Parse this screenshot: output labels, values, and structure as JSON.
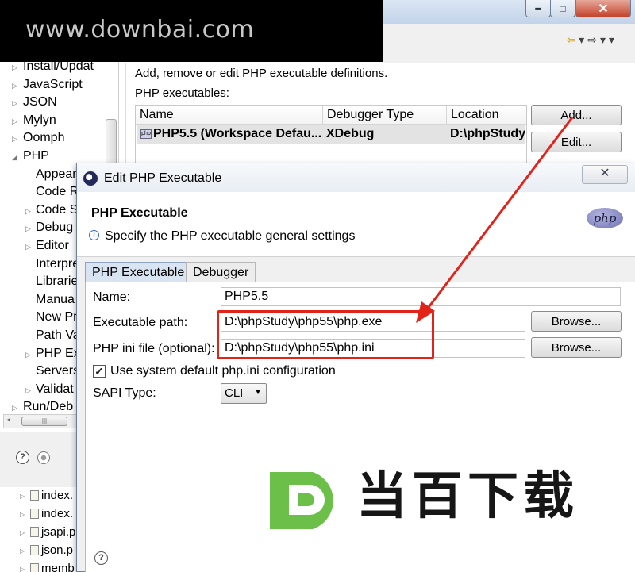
{
  "banner": {
    "text": "www.downbai.com"
  },
  "prefs": {
    "window_buttons": {
      "minimize": "━",
      "maximize": "□",
      "close": "✕"
    },
    "tree": [
      {
        "label": "Install/Updat",
        "arrow": "▷"
      },
      {
        "label": "JavaScript",
        "arrow": "▷"
      },
      {
        "label": "JSON",
        "arrow": "▷"
      },
      {
        "label": "Mylyn",
        "arrow": "▷"
      },
      {
        "label": "Oomph",
        "arrow": "▷"
      },
      {
        "label": "PHP",
        "arrow": "◢"
      },
      {
        "label": "Appear",
        "arrow": ""
      },
      {
        "label": "Code R",
        "arrow": ""
      },
      {
        "label": "Code S",
        "arrow": "▷"
      },
      {
        "label": "Debug",
        "arrow": "▷"
      },
      {
        "label": "Editor",
        "arrow": "▷"
      },
      {
        "label": "Interpre",
        "arrow": ""
      },
      {
        "label": "Librarie",
        "arrow": ""
      },
      {
        "label": "Manua",
        "arrow": ""
      },
      {
        "label": "New Pr",
        "arrow": ""
      },
      {
        "label": "Path Va",
        "arrow": ""
      },
      {
        "label": "PHP Ex",
        "arrow": "▷"
      },
      {
        "label": "Servers",
        "arrow": ""
      },
      {
        "label": "Validat",
        "arrow": "▷"
      },
      {
        "label": "Run/Deb",
        "arrow": "▷"
      }
    ],
    "description": "Add, remove or edit PHP executable definitions.",
    "table_label": "PHP executables:",
    "columns": [
      "Name",
      "Debugger Type",
      "Location"
    ],
    "rows": [
      {
        "name": "PHP5.5 (Workspace Defau...",
        "debugger": "XDebug",
        "location": "D:\\phpStudy"
      }
    ],
    "buttons": {
      "add": "Add...",
      "edit": "Edit..."
    },
    "files": [
      "index.",
      "index.",
      "jsapi.p",
      "json.p",
      "memb"
    ]
  },
  "dialog": {
    "title": "Edit PHP Executable",
    "heading": "PHP Executable",
    "message": "Specify the PHP executable general settings",
    "logo": "php",
    "tabs": [
      "PHP Executable",
      "Debugger"
    ],
    "fields": {
      "name_label": "Name:",
      "name_value": "PHP5.5",
      "exe_label": "Executable path:",
      "exe_value": "D:\\phpStudy\\php55\\php.exe",
      "ini_label": "PHP ini file (optional):",
      "ini_value": "D:\\phpStudy\\php55\\php.ini",
      "browse": "Browse...",
      "checkbox_label": "Use system default php.ini configuration",
      "checkbox_checked": true,
      "sapi_label": "SAPI Type:",
      "sapi_value": "CLI"
    }
  },
  "watermark_logo": {
    "letter": "D",
    "text": "当百下载"
  },
  "colors": {
    "annotation_red": "#e2231a",
    "logo_green": "#6cc04a"
  }
}
